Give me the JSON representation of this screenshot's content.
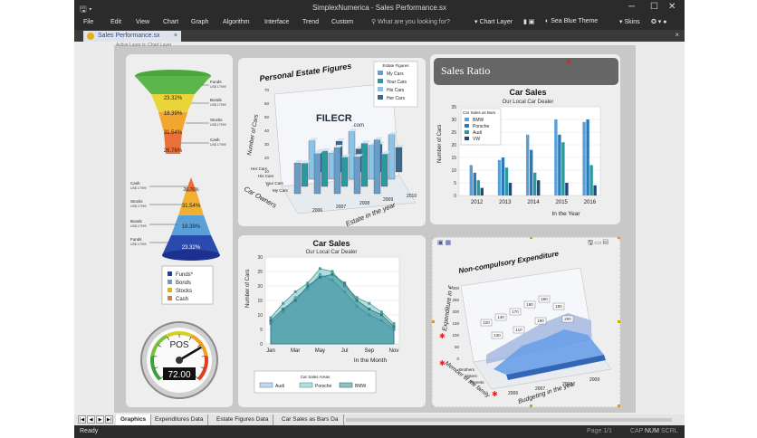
{
  "window": {
    "title": "SimplexNumerica - Sales Performance.sx"
  },
  "menu": {
    "items": [
      "File",
      "Edit",
      "View",
      "Chart",
      "Graph",
      "Algorithm",
      "Interface",
      "Trend",
      "Custom"
    ],
    "search_placeholder": "What are you looking for?",
    "chart_layer": "Chart Layer",
    "theme": "Sea Blue Theme",
    "skins": "Skins"
  },
  "document_tab": {
    "label": "Sales Performance.sx"
  },
  "canvas": {
    "hint": "Active Layer is: Chart Layer"
  },
  "funnel": {
    "labels": [
      "Funds",
      "Bonds",
      "Stocks",
      "Cash"
    ],
    "sublabel": "US$ 17999",
    "values": [
      "23.32%",
      "18.39%",
      "31.54%",
      "26.76%"
    ]
  },
  "pyramid": {
    "labels": [
      "Cash",
      "Stocks",
      "Bonds",
      "Funds"
    ],
    "sublabel": "US$ 17999",
    "values": [
      "26.76%",
      "31.54%",
      "18.39%",
      "23.32%"
    ]
  },
  "legend_small": {
    "items": [
      "Funds*",
      "Bonds",
      "Stocks",
      "Cash"
    ],
    "colors": [
      "#1c3fa0",
      "#5aa0d8",
      "#e0b020",
      "#e0783a"
    ]
  },
  "gauge": {
    "label": "POS",
    "value": "72.00",
    "ticks": [
      "0",
      "10",
      "20",
      "30",
      "40",
      "50",
      "60",
      "70",
      "80",
      "90",
      "100"
    ]
  },
  "estate": {
    "title": "Personal Estate Figures",
    "legend_title": "Estate Figures",
    "legend": [
      "My Cars",
      "Your Cars",
      "His Cars",
      "Her Cars"
    ],
    "ylabel": "Number of Cars",
    "yticks": [
      "0",
      "10",
      "20",
      "30",
      "40",
      "50",
      "60",
      "70"
    ],
    "xticks": [
      "2006",
      "2007",
      "2008",
      "2009",
      "2010"
    ],
    "xlabel": "Estate in the year",
    "zlabel": "Car Owners",
    "zticks": [
      "Her Cars",
      "His Cars",
      "Your Cars",
      "My Cars"
    ],
    "watermark": "FILECR",
    "watermark_sub": ".com"
  },
  "sales_ratio": {
    "header": "Sales Ratio",
    "title": "Car Sales",
    "subtitle": "Our Local Car Dealer",
    "legend_title": "Car Sales as Bars",
    "legend": [
      "BMW",
      "Porsche",
      "Audi",
      "VW"
    ],
    "ylabel": "Number of Cars",
    "xlabel": "In the Year",
    "xticks": [
      "2012",
      "2013",
      "2014",
      "2015",
      "2016"
    ],
    "yticks": [
      "0",
      "5",
      "10",
      "15",
      "20",
      "25",
      "30",
      "35"
    ]
  },
  "car_sales_area": {
    "title": "Car Sales",
    "subtitle": "Our Local Car Dealer",
    "ylabel": "Number of Cars",
    "xlabel": "In the Month",
    "xticks": [
      "Jan",
      "Mar",
      "May",
      "Jul",
      "Sep",
      "Nov"
    ],
    "yticks": [
      "0",
      "5",
      "10",
      "15",
      "20",
      "25",
      "30"
    ],
    "legend_title": "Car Sales Areas",
    "legend": [
      "Audi",
      "Porsche",
      "BMW"
    ]
  },
  "expenditure": {
    "title": "Non-compulsory Expenditure",
    "ylabel": "Expenditure in €",
    "xlabel": "Budgeting in the year",
    "zlabel": "Member of the family",
    "yticks": [
      "0",
      "50",
      "100",
      "150",
      "200",
      "250",
      "300"
    ],
    "xticks": [
      "2006",
      "2007",
      "2008",
      "2009"
    ],
    "zticks": [
      "Brothers",
      "Sisters",
      "Parents"
    ],
    "value_labels": [
      "120",
      "140",
      "170",
      "180",
      "160",
      "150",
      "130",
      "110",
      "190",
      "200"
    ]
  },
  "sheet_tabs": [
    "Graphics",
    "Expenditures Data",
    "Estate Figures Data",
    "Car Sales as Bars Da"
  ],
  "status": {
    "ready": "Ready",
    "page": "Page 1/1",
    "caps": "CAP",
    "num": "NUM",
    "scrl": "SCRL"
  },
  "chart_data": [
    {
      "type": "bar",
      "title": "Car Sales",
      "subtitle": "Our Local Car Dealer",
      "xlabel": "In the Year",
      "ylabel": "Number of Cars",
      "categories": [
        "2012",
        "2013",
        "2014",
        "2015",
        "2016"
      ],
      "ylim": [
        0,
        35
      ],
      "series": [
        {
          "name": "BMW",
          "values": [
            12,
            14,
            24,
            30,
            29
          ]
        },
        {
          "name": "Porsche",
          "values": [
            9,
            15,
            18,
            24,
            30
          ]
        },
        {
          "name": "Audi",
          "values": [
            6,
            11,
            9,
            21,
            12
          ]
        },
        {
          "name": "VW",
          "values": [
            3,
            5,
            6,
            5,
            4
          ]
        }
      ]
    },
    {
      "type": "area",
      "title": "Car Sales",
      "subtitle": "Our Local Car Dealer",
      "xlabel": "In the Month",
      "ylabel": "Number of Cars",
      "x": [
        "Jan",
        "Feb",
        "Mar",
        "Apr",
        "May",
        "Jun",
        "Jul",
        "Aug",
        "Sep",
        "Oct",
        "Nov"
      ],
      "ylim": [
        0,
        30
      ],
      "series": [
        {
          "name": "Audi",
          "values": [
            7,
            11,
            16,
            19,
            24,
            22,
            18,
            13,
            10,
            8,
            5
          ]
        },
        {
          "name": "Porsche",
          "values": [
            9,
            14,
            18,
            21,
            26,
            25,
            20,
            16,
            14,
            11,
            7
          ]
        },
        {
          "name": "BMW",
          "values": [
            8,
            12,
            15,
            20,
            23,
            24,
            21,
            15,
            12,
            10,
            6
          ]
        }
      ]
    }
  ]
}
